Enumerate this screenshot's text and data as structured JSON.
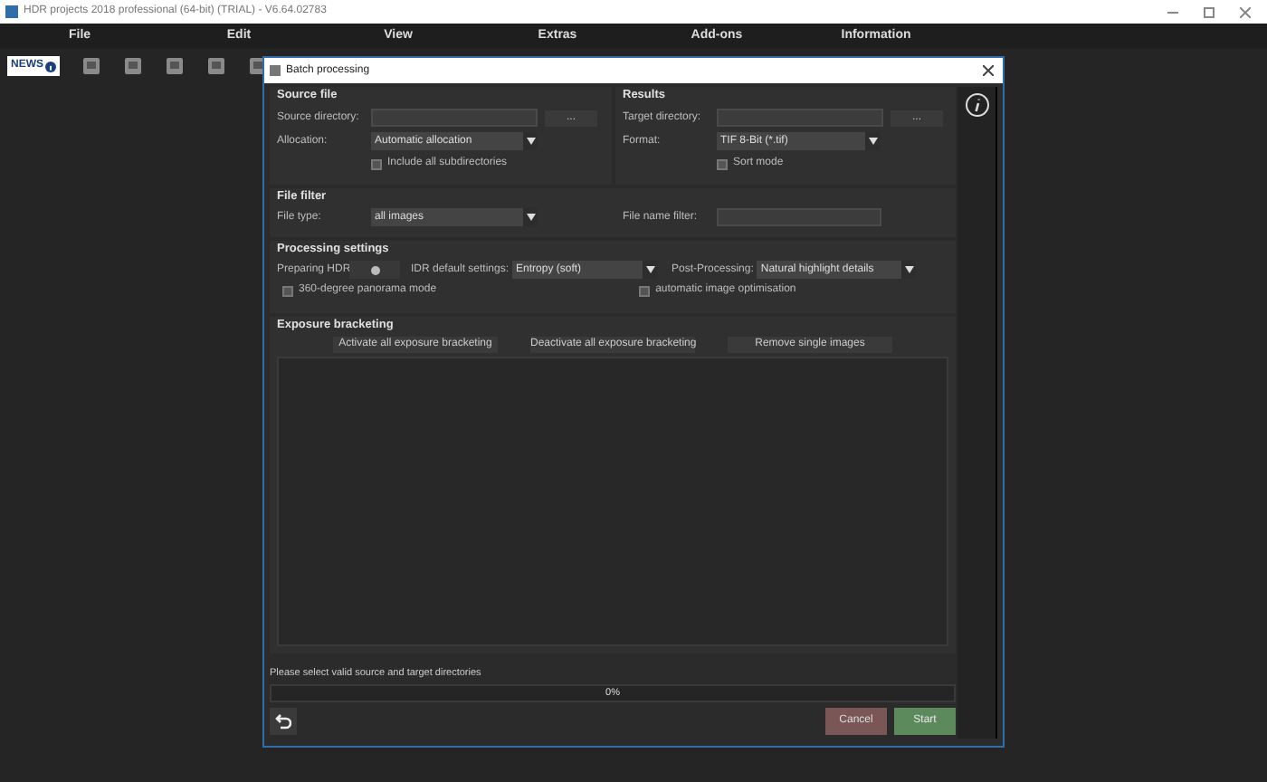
{
  "window": {
    "title": "HDR projects 2018 professional (64-bit) (TRIAL) - V6.64.02783"
  },
  "menu": [
    "File",
    "Edit",
    "View",
    "Extras",
    "Add-ons",
    "Information"
  ],
  "toolbar": {
    "news": "NEWS"
  },
  "dialog": {
    "title": "Batch processing",
    "source": {
      "heading": "Source file",
      "directory_label": "Source directory:",
      "browse": "...",
      "allocation_label": "Allocation:",
      "allocation_value": "Automatic allocation",
      "subdirs": {
        "label": "Include all subdirectories",
        "checked": false
      }
    },
    "results": {
      "heading": "Results",
      "directory_label": "Target directory:",
      "browse": "...",
      "format_label": "Format:",
      "format_value": "TIF 8-Bit (*.tif)",
      "sort": {
        "label": "Sort mode",
        "checked": false
      }
    },
    "filter": {
      "heading": "File filter",
      "type_label": "File type:",
      "type_value": "all images",
      "name_label": "File name filter:"
    },
    "processing": {
      "heading": "Processing settings",
      "preparing_label": "Preparing HDR",
      "defaults_label": "IDR default settings:",
      "defaults_value": "Entropy (soft)",
      "post_label": "Post-Processing:",
      "post_value": "Natural highlight details",
      "panorama": {
        "label": "360-degree panorama mode",
        "checked": false
      },
      "optimisation": {
        "label": "automatic image optimisation",
        "checked": false
      }
    },
    "bracketing": {
      "heading": "Exposure bracketing",
      "buttons": [
        "Activate all exposure bracketing",
        "Deactivate all exposure bracketing",
        "Remove single images"
      ]
    },
    "status": "Please select valid source and target directories",
    "progress": {
      "level": 0,
      "text": "0%"
    },
    "cancel": "Cancel",
    "start": "Start"
  }
}
